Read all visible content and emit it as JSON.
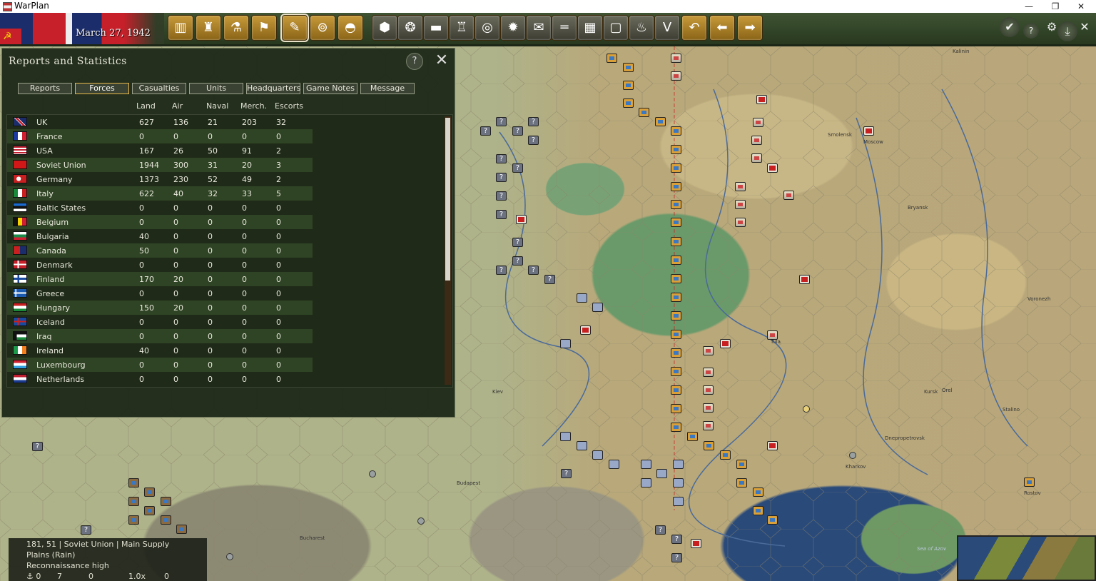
{
  "window": {
    "title": "WarPlan",
    "controls": [
      "—",
      "❐",
      "✕"
    ]
  },
  "topbar": {
    "date": "March 27, 1942",
    "icons": [
      "factory-icon",
      "production-icon",
      "research-icon",
      "flag-icon",
      "reports-icon",
      "recon-icon",
      "helmet-icon",
      "hex-filter-icon",
      "supply-icon",
      "tank-filter-icon",
      "hq-filter-icon",
      "target-icon",
      "resource-icon",
      "convoy-icon",
      "rail-icon",
      "grid-icon",
      "border-icon",
      "fire-icon",
      "victory-icon",
      "undo-icon",
      "prev-icon",
      "next-icon"
    ],
    "right_icons": [
      "end-turn-check-icon",
      "help-icon",
      "settings-gears-icon",
      "save-icon",
      "exit-icon"
    ]
  },
  "panel": {
    "title": "Reports and Statistics",
    "help": "?",
    "close": "✕",
    "tabs": [
      "Reports",
      "Forces",
      "Casualties",
      "Units",
      "Headquarters",
      "Game Notes",
      "Message"
    ],
    "active_tab": "Forces",
    "columns": [
      "Land",
      "Air",
      "Naval",
      "Merch.",
      "Escorts"
    ],
    "rows": [
      {
        "name": "UK",
        "land": "627",
        "air": "136",
        "naval": "21",
        "merch": "203",
        "escorts": "32",
        "flag": "uk"
      },
      {
        "name": "France",
        "land": "0",
        "air": "0",
        "naval": "0",
        "merch": "0",
        "escorts": "0",
        "flag": "france"
      },
      {
        "name": "USA",
        "land": "167",
        "air": "26",
        "naval": "50",
        "merch": "91",
        "escorts": "2",
        "flag": "usa"
      },
      {
        "name": "Soviet Union",
        "land": "1944",
        "air": "300",
        "naval": "31",
        "merch": "20",
        "escorts": "3",
        "flag": "ussr"
      },
      {
        "name": "Germany",
        "land": "1373",
        "air": "230",
        "naval": "52",
        "merch": "49",
        "escorts": "2",
        "flag": "germany"
      },
      {
        "name": "Italy",
        "land": "622",
        "air": "40",
        "naval": "32",
        "merch": "33",
        "escorts": "5",
        "flag": "italy"
      },
      {
        "name": "Baltic States",
        "land": "0",
        "air": "0",
        "naval": "0",
        "merch": "0",
        "escorts": "0",
        "flag": "baltic"
      },
      {
        "name": "Belgium",
        "land": "0",
        "air": "0",
        "naval": "0",
        "merch": "0",
        "escorts": "0",
        "flag": "belgium"
      },
      {
        "name": "Bulgaria",
        "land": "40",
        "air": "0",
        "naval": "0",
        "merch": "0",
        "escorts": "0",
        "flag": "bulgaria"
      },
      {
        "name": "Canada",
        "land": "50",
        "air": "0",
        "naval": "0",
        "merch": "0",
        "escorts": "0",
        "flag": "canada"
      },
      {
        "name": "Denmark",
        "land": "0",
        "air": "0",
        "naval": "0",
        "merch": "0",
        "escorts": "0",
        "flag": "denmark"
      },
      {
        "name": "Finland",
        "land": "170",
        "air": "20",
        "naval": "0",
        "merch": "0",
        "escorts": "0",
        "flag": "finland"
      },
      {
        "name": "Greece",
        "land": "0",
        "air": "0",
        "naval": "0",
        "merch": "0",
        "escorts": "0",
        "flag": "greece"
      },
      {
        "name": "Hungary",
        "land": "150",
        "air": "20",
        "naval": "0",
        "merch": "0",
        "escorts": "0",
        "flag": "hungary"
      },
      {
        "name": "Iceland",
        "land": "0",
        "air": "0",
        "naval": "0",
        "merch": "0",
        "escorts": "0",
        "flag": "iceland"
      },
      {
        "name": "Iraq",
        "land": "0",
        "air": "0",
        "naval": "0",
        "merch": "0",
        "escorts": "0",
        "flag": "iraq"
      },
      {
        "name": "Ireland",
        "land": "40",
        "air": "0",
        "naval": "0",
        "merch": "0",
        "escorts": "0",
        "flag": "ireland"
      },
      {
        "name": "Luxembourg",
        "land": "0",
        "air": "0",
        "naval": "0",
        "merch": "0",
        "escorts": "0",
        "flag": "luxembourg"
      },
      {
        "name": "Netherlands",
        "land": "0",
        "air": "0",
        "naval": "0",
        "merch": "0",
        "escorts": "0",
        "flag": "netherlands"
      }
    ]
  },
  "hexinfo": {
    "line1": "181, 51 | Soviet Union | Main Supply",
    "line2": "Plains (Rain)",
    "line3": "Reconnaissance high",
    "stats": [
      "⚓ 0",
      "7",
      "0",
      "1.0x",
      "0"
    ]
  },
  "map_labels": [
    "Bryansk",
    "Kursk",
    "Orel",
    "Tula",
    "Kharkov",
    "Voronezh",
    "Kiev",
    "Smolensk",
    "Moscow",
    "Rostov",
    "Stalino",
    "Dnepropetrovsk",
    "Budapest",
    "Bucharest",
    "Sea of Azov",
    "Kalinin"
  ],
  "colors": {
    "panel_bg": "#1c2616",
    "row_alt": "#2f4424",
    "active_tab_border": "#e6b84a",
    "toolbar_gold": "#c79a3a"
  }
}
